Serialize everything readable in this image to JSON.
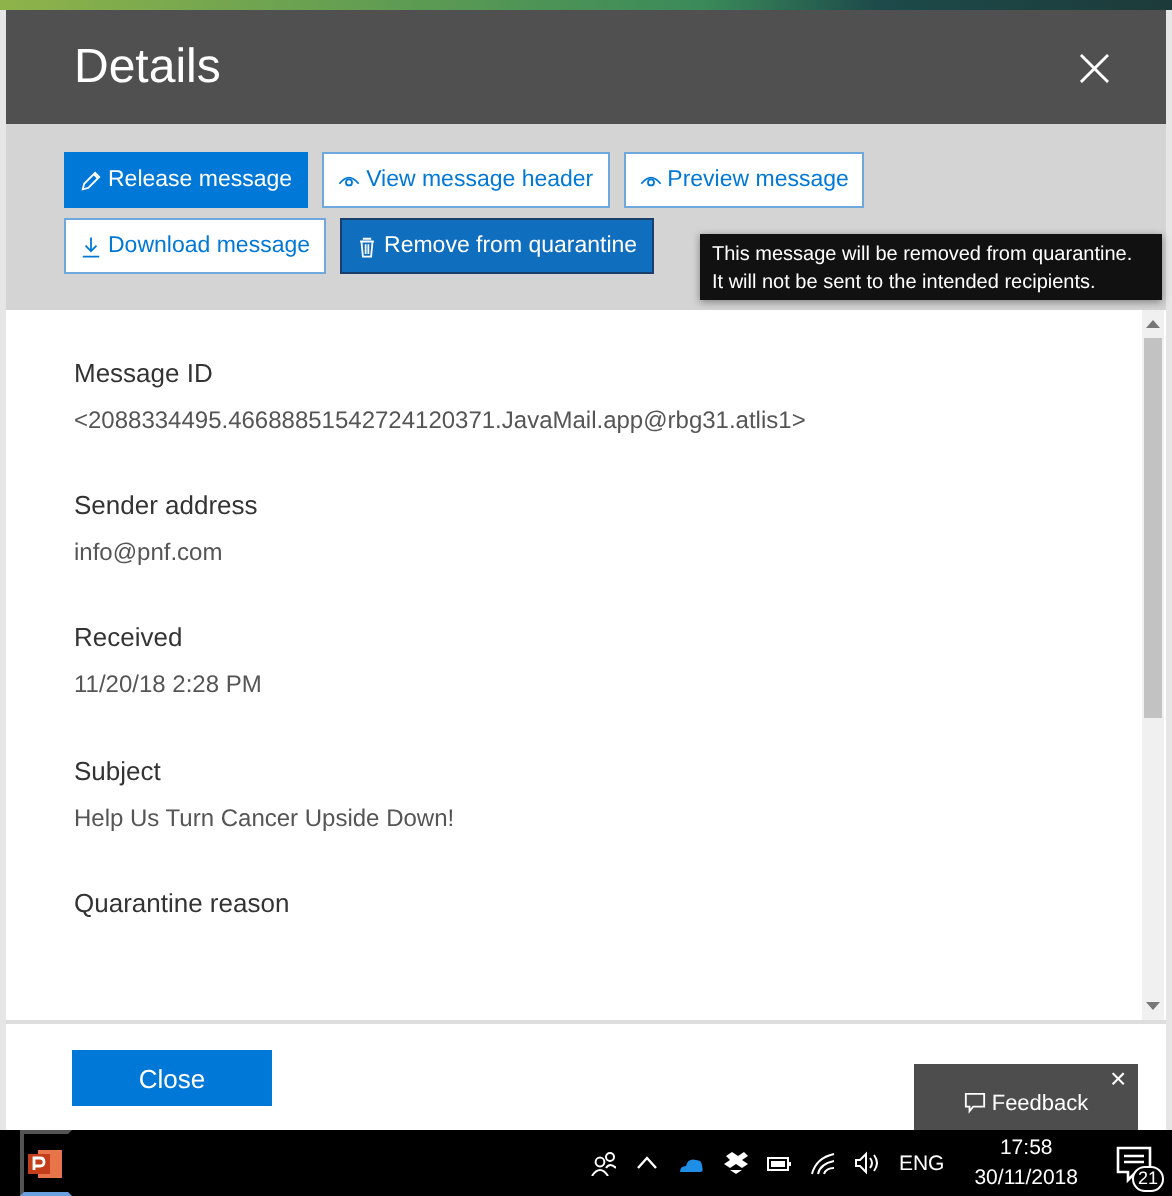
{
  "dialog": {
    "title": "Details",
    "close": "×"
  },
  "actions": [
    {
      "label": "Release message",
      "kind": "primary"
    },
    {
      "label": "View message header",
      "kind": "outline"
    },
    {
      "label": "Preview message",
      "kind": "outline"
    },
    {
      "label": "Download message",
      "kind": "outline"
    },
    {
      "label": "Remove from quarantine",
      "kind": "hovered"
    }
  ],
  "tooltip": [
    "This message will be removed from quarantine.",
    "It will not be sent to the intended recipients."
  ],
  "fields": [
    {
      "label": "Message ID",
      "value": "<2088334495.46688851542724120371.JavaMail.app@rbg31.atlis1>"
    },
    {
      "label": "Sender address",
      "value": "info@pnf.com"
    },
    {
      "label": "Received",
      "value": "11/20/18 2:28 PM"
    },
    {
      "label": "Subject",
      "value": "Help Us Turn Cancer Upside Down!"
    },
    {
      "label": "Quarantine reason"
    }
  ],
  "footer": {
    "button": "Close"
  },
  "feedback": {
    "label": "Feedback",
    "close": "×"
  },
  "taskbar": {
    "language": "ENG",
    "time": "17:58",
    "date": "30/11/2018",
    "notifications": "21"
  }
}
